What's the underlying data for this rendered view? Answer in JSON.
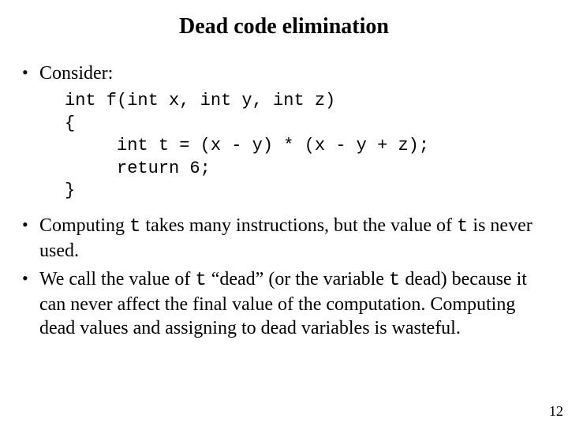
{
  "title": "Dead code elimination",
  "bullet1": "Consider:",
  "code": "int f(int x, int y, int z)\n{\n     int t = (x - y) * (x - y + z);\n     return 6;\n}",
  "bullet2_a": "Computing ",
  "bullet2_t1": "t",
  "bullet2_b": " takes many instructions, but the value of ",
  "bullet2_t2": "t",
  "bullet2_c": " is never used.",
  "bullet3_a": "We call the value of ",
  "bullet3_t1": "t",
  "bullet3_b": " “dead” (or the variable ",
  "bullet3_t2": "t",
  "bullet3_c": " dead) because it can never affect the final value of the computation.  Computing dead values and assigning to dead variables is wasteful.",
  "page_number": "12"
}
